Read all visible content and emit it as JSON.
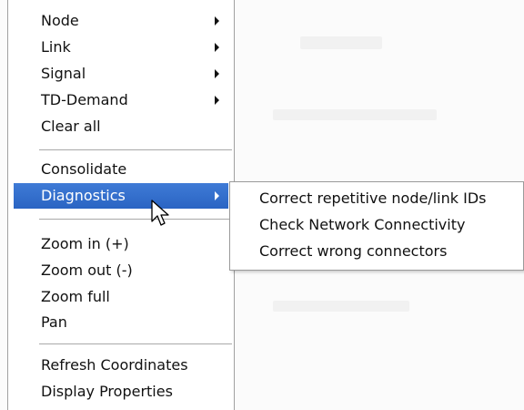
{
  "context_menu": {
    "items": [
      {
        "label": "Node",
        "submenu": true
      },
      {
        "label": "Link",
        "submenu": true
      },
      {
        "label": "Signal",
        "submenu": true
      },
      {
        "label": "TD-Demand",
        "submenu": true
      },
      {
        "label": "Clear all",
        "submenu": false
      },
      {
        "label": "Consolidate",
        "submenu": false
      },
      {
        "label": "Diagnostics",
        "submenu": true,
        "selected": true
      },
      {
        "label": "Zoom in (+)",
        "submenu": false
      },
      {
        "label": "Zoom out (-)",
        "submenu": false
      },
      {
        "label": "Zoom full",
        "submenu": false
      },
      {
        "label": "Pan",
        "submenu": false
      },
      {
        "label": "Refresh Coordinates",
        "submenu": false
      },
      {
        "label": "Display Properties",
        "submenu": false
      }
    ]
  },
  "diagnostics_submenu": {
    "items": [
      {
        "label": "Correct repetitive node/link IDs"
      },
      {
        "label": "Check Network Connectivity"
      },
      {
        "label": "Correct wrong connectors"
      }
    ]
  },
  "colors": {
    "selection": "#2f6bcc",
    "menu_text": "#111111",
    "border": "#a0a0a0"
  },
  "icons": {
    "submenu_indicator": "chevron-right-icon",
    "pointer": "mouse-cursor-icon"
  }
}
